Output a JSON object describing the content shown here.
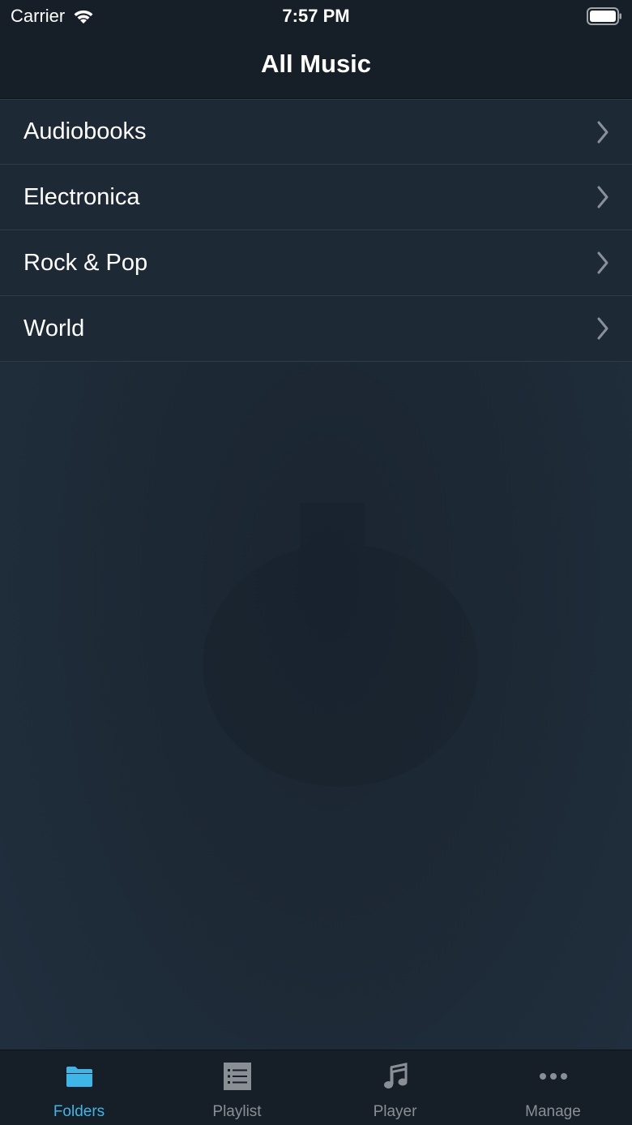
{
  "status_bar": {
    "carrier": "Carrier",
    "time": "7:57 PM"
  },
  "nav": {
    "title": "All Music"
  },
  "folders": [
    {
      "label": "Audiobooks"
    },
    {
      "label": "Electronica"
    },
    {
      "label": "Rock & Pop"
    },
    {
      "label": "World"
    }
  ],
  "tab_bar": {
    "active_color": "#3fb6e8",
    "inactive_color": "#8a8f96",
    "tabs": [
      {
        "label": "Folders",
        "icon": "folder-icon",
        "active": true
      },
      {
        "label": "Playlist",
        "icon": "list-icon",
        "active": false
      },
      {
        "label": "Player",
        "icon": "music-note-icon",
        "active": false
      },
      {
        "label": "Manage",
        "icon": "more-icon",
        "active": false
      }
    ]
  }
}
